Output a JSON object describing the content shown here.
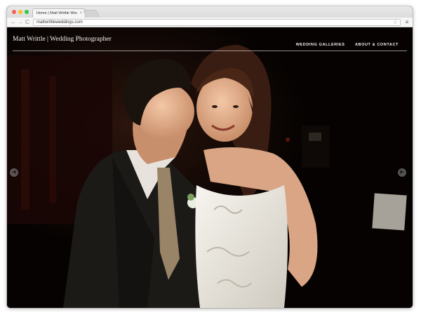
{
  "browser": {
    "tab_title": "Home | Matt Writtle Wedd",
    "tab_close": "×",
    "url": "mattwrittleweddings.com",
    "icons": {
      "back": "←",
      "forward": "→",
      "reload": "C",
      "bookmark": "☆",
      "menu": "≡"
    }
  },
  "site": {
    "title": "Matt Writtle | Wedding Photographer",
    "nav": [
      "WEDDING GALLERIES",
      "ABOUT & CONTACT"
    ]
  },
  "slideshow": {
    "prev_icon": "◀",
    "next_icon": "▶"
  },
  "colors": {
    "background": "#050201",
    "header_text": "#f2f2f2",
    "dress": "#f2f0ea",
    "suit": "#1c1a17",
    "tie": "#9a8468"
  }
}
